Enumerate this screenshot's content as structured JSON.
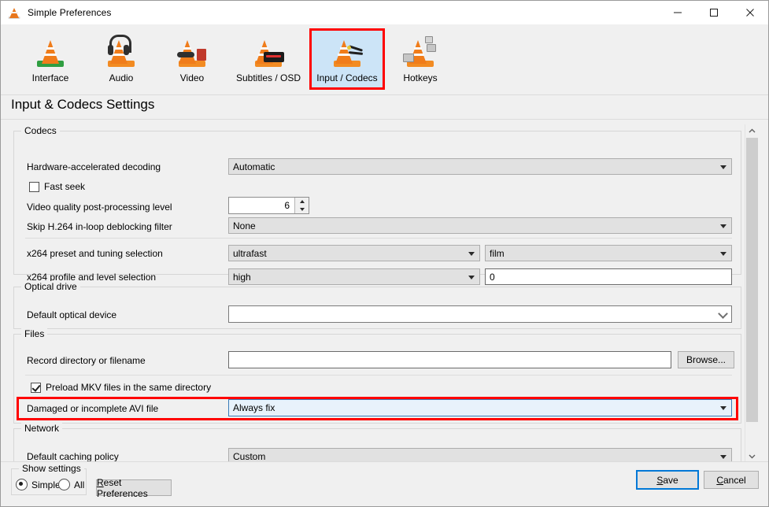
{
  "window": {
    "title": "Simple Preferences",
    "icon": "vlc-cone-icon",
    "controls": {
      "minimize": "minimize-icon",
      "maximize": "maximize-icon",
      "close": "close-icon"
    }
  },
  "toolbar": {
    "items": [
      {
        "label": "Interface",
        "icon": "interface-cone-icon",
        "selected": false
      },
      {
        "label": "Audio",
        "icon": "audio-cone-icon",
        "selected": false
      },
      {
        "label": "Video",
        "icon": "video-cone-icon",
        "selected": false
      },
      {
        "label": "Subtitles / OSD",
        "icon": "subtitles-cone-icon",
        "selected": false
      },
      {
        "label": "Input / Codecs",
        "icon": "input-codecs-cone-icon",
        "selected": true
      },
      {
        "label": "Hotkeys",
        "icon": "hotkeys-cone-icon",
        "selected": false
      }
    ]
  },
  "page": {
    "title": "Input & Codecs Settings"
  },
  "sections": {
    "codecs": {
      "legend": "Codecs",
      "hardware_decoding": {
        "label": "Hardware-accelerated decoding",
        "value": "Automatic"
      },
      "fast_seek": {
        "label": "Fast seek",
        "checked": false
      },
      "post_processing": {
        "label": "Video quality post-processing level",
        "value": "6"
      },
      "deblocking": {
        "label": "Skip H.264 in-loop deblocking filter",
        "value": "None"
      },
      "x264_preset": {
        "label": "x264 preset and tuning selection",
        "value": "ultrafast",
        "tuning": "film"
      },
      "x264_profile": {
        "label": "x264 profile and level selection",
        "value": "high",
        "level": "0"
      }
    },
    "optical": {
      "legend": "Optical drive",
      "default_device": {
        "label": "Default optical device",
        "value": ""
      }
    },
    "files": {
      "legend": "Files",
      "record_dir": {
        "label": "Record directory or filename",
        "value": ""
      },
      "browse_label": "Browse...",
      "preload_mkv": {
        "label": "Preload MKV files in the same directory",
        "checked": true
      },
      "avi_file": {
        "label": "Damaged or incomplete AVI file",
        "value": "Always fix",
        "highlighted": true
      }
    },
    "network": {
      "legend": "Network",
      "caching_policy": {
        "label": "Default caching policy",
        "value": "Custom"
      }
    }
  },
  "footer": {
    "show_settings": {
      "legend": "Show settings",
      "simple": {
        "label": "Simple",
        "selected": true
      },
      "all": {
        "label": "All",
        "selected": false
      }
    },
    "reset": {
      "label": "Reset Preferences",
      "mnemonic": "R"
    },
    "save": {
      "label": "Save",
      "mnemonic": "S",
      "focused": true
    },
    "cancel": {
      "label": "Cancel",
      "mnemonic": "C"
    }
  },
  "colors": {
    "accent_highlight": "#ff0000",
    "selection_blue": "#cce4f7",
    "focus_blue": "#0078d7",
    "window_bg": "#f0f0f0",
    "vlc_orange": "#f07c1a"
  }
}
